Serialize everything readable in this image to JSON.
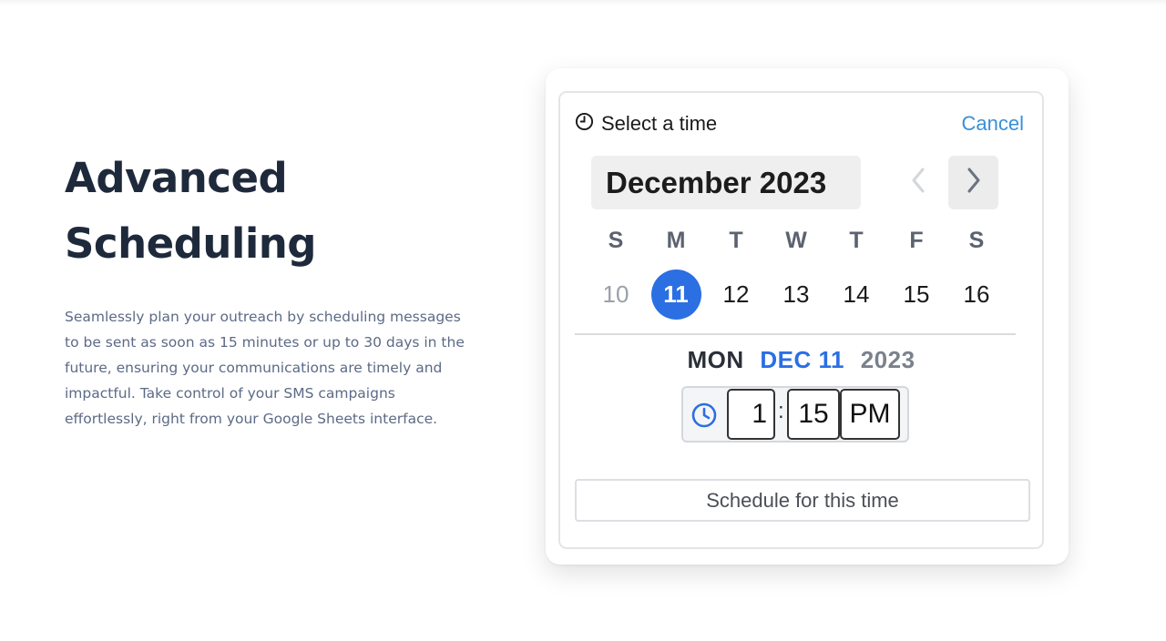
{
  "hero": {
    "title_line1": "Advanced",
    "title_line2": "Scheduling",
    "description": "Seamlessly plan your outreach by scheduling messages to be sent as soon as 15 minutes or up to 30 days in the future, ensuring your communications are timely and impactful. Take control of your SMS campaigns effortlessly, right from your Google Sheets interface."
  },
  "picker": {
    "header_title": "Select a time",
    "cancel_label": "Cancel",
    "month_label": "December 2023",
    "weekdays": [
      "S",
      "M",
      "T",
      "W",
      "T",
      "F",
      "S"
    ],
    "days": [
      {
        "label": "10",
        "state": "muted"
      },
      {
        "label": "11",
        "state": "selected"
      },
      {
        "label": "12",
        "state": "normal"
      },
      {
        "label": "13",
        "state": "normal"
      },
      {
        "label": "14",
        "state": "normal"
      },
      {
        "label": "15",
        "state": "normal"
      },
      {
        "label": "16",
        "state": "normal"
      }
    ],
    "selected_dow": "MON",
    "selected_date": "DEC 11",
    "selected_year": "2023",
    "time": {
      "hour": "1",
      "separator": ":",
      "minute": "15",
      "ampm": "PM"
    },
    "schedule_label": "Schedule for this time"
  },
  "colors": {
    "accent": "#2b6fe3",
    "link": "#3a8fd9",
    "heading": "#1e2a3b",
    "body_text": "#5c6a86"
  },
  "icons": {
    "header": "clock-icon",
    "prev": "chevron-left-icon",
    "next": "chevron-right-icon",
    "time": "clock-icon"
  }
}
